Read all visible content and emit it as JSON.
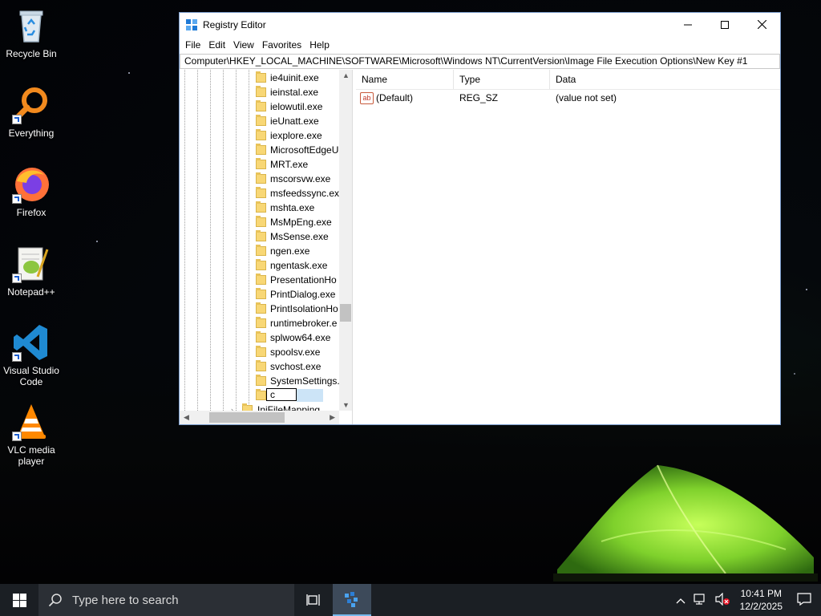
{
  "desktop": {
    "icons": [
      {
        "label": "Recycle Bin",
        "icon": "recycle-bin-icon"
      },
      {
        "label": "Everything",
        "icon": "everything-search-icon"
      },
      {
        "label": "Firefox",
        "icon": "firefox-icon"
      },
      {
        "label": "Notepad++",
        "icon": "notepad-plus-plus-icon"
      },
      {
        "label": "Visual Studio Code",
        "icon": "vscode-icon"
      },
      {
        "label": "VLC media player",
        "icon": "vlc-icon"
      }
    ]
  },
  "window": {
    "title": "Registry Editor",
    "menu": [
      "File",
      "Edit",
      "View",
      "Favorites",
      "Help"
    ],
    "address": "Computer\\HKEY_LOCAL_MACHINE\\SOFTWARE\\Microsoft\\Windows NT\\CurrentVersion\\Image File Execution Options\\New Key #1",
    "tree": {
      "keys": [
        "ie4uinit.exe",
        "ieinstal.exe",
        "ielowutil.exe",
        "ieUnatt.exe",
        "iexplore.exe",
        "MicrosoftEdgeU",
        "MRT.exe",
        "mscorsvw.exe",
        "msfeedssync.ex",
        "mshta.exe",
        "MsMpEng.exe",
        "MsSense.exe",
        "ngen.exe",
        "ngentask.exe",
        "PresentationHo",
        "PrintDialog.exe",
        "PrintIsolationHo",
        "runtimebroker.e",
        "splwow64.exe",
        "spoolsv.exe",
        "svchost.exe",
        "SystemSettings."
      ],
      "editing_value": "c",
      "sibling_key": "IniFileMapping"
    },
    "list": {
      "columns": [
        "Name",
        "Type",
        "Data"
      ],
      "rows": [
        {
          "name": "(Default)",
          "type": "REG_SZ",
          "data": "(value not set)"
        }
      ]
    }
  },
  "taskbar": {
    "search_placeholder": "Type here to search",
    "time": "10:41 PM",
    "date": "12/2/2025"
  },
  "colors": {
    "accent": "#0078d7",
    "taskbar": "#1b1f24",
    "folder": "#f8d775",
    "tent": "#8fe03a"
  }
}
